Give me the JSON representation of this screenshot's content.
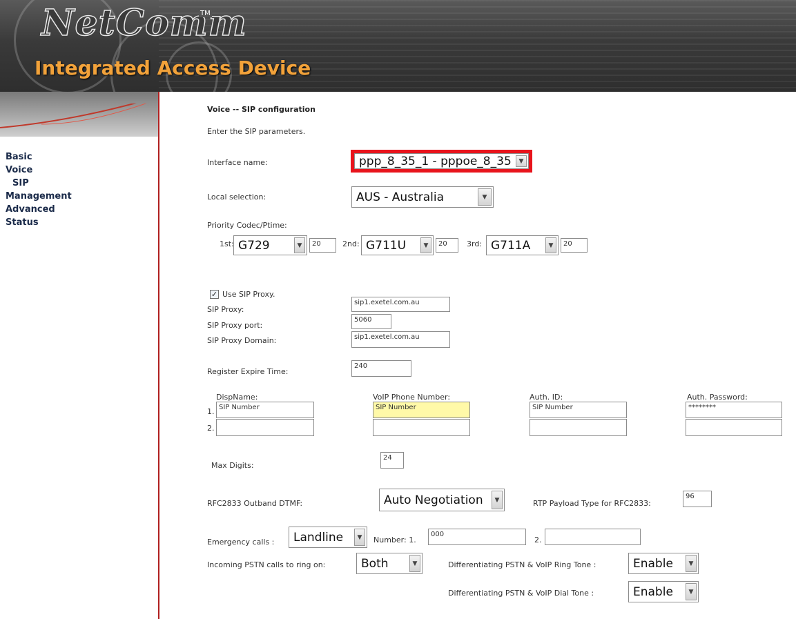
{
  "header": {
    "logo_text": "NetComm",
    "trademark": "TM",
    "product": "Integrated Access Device"
  },
  "nav": {
    "items": [
      "Basic",
      "Voice",
      "SIP",
      "Management",
      "Advanced",
      "Status"
    ]
  },
  "page": {
    "title": "Voice -- SIP configuration",
    "subtitle": "Enter the SIP parameters.",
    "interface": {
      "label": "Interface name:",
      "value": "ppp_8_35_1 - pppoe_8_35"
    },
    "locale": {
      "label": "Local selection:",
      "value": "AUS - Australia"
    },
    "codec": {
      "label": "Priority Codec/Ptime:",
      "first": {
        "label": "1st:",
        "codec": "G729",
        "ptime": "20"
      },
      "second": {
        "label": "2nd:",
        "codec": "G711U",
        "ptime": "20"
      },
      "third": {
        "label": "3rd:",
        "codec": "G711A",
        "ptime": "20"
      }
    },
    "proxy": {
      "use_label": "Use SIP Proxy.",
      "use_checked": true,
      "proxy_label": "SIP Proxy:",
      "proxy_value": "sip1.exetel.com.au",
      "port_label": "SIP Proxy port:",
      "port_value": "5060",
      "domain_label": "SIP Proxy Domain:",
      "domain_value": "sip1.exetel.com.au"
    },
    "register": {
      "label": "Register Expire Time:",
      "value": "240"
    },
    "accounts": {
      "headers": [
        "DispName:",
        "VoIP Phone Number:",
        "Auth. ID:",
        "Auth. Password:"
      ],
      "rows": [
        {
          "index": "1.",
          "disp": "SIP Number",
          "phone": "SIP Number",
          "auth": "SIP Number",
          "password": "********"
        },
        {
          "index": "2.",
          "disp": "",
          "phone": "",
          "auth": "",
          "password": ""
        }
      ]
    },
    "max_digits": {
      "label": "Max Digits:",
      "value": "24"
    },
    "dtmf": {
      "label": "RFC2833 Outband DTMF:",
      "value": "Auto Negotiation"
    },
    "rtp": {
      "label": "RTP Payload Type for RFC2833:",
      "value": "96"
    },
    "emergency": {
      "label": "Emergency calls :",
      "value": "Landline",
      "number_label": "Number: 1.",
      "number1": "000",
      "number2_label": "2.",
      "number2": ""
    },
    "incoming": {
      "label": "Incoming PSTN calls to ring on:",
      "value": "Both"
    },
    "ring_tone": {
      "label": "Differentiating PSTN & VoIP Ring Tone :",
      "value": "Enable"
    },
    "dial_tone": {
      "label": "Differentiating PSTN & VoIP Dial Tone :",
      "value": "Enable"
    }
  },
  "colors": {
    "highlight_border": "#e8141c",
    "nav_text": "#1b2b4a",
    "product_text": "#f2a23a",
    "divider": "#b02020",
    "highlight_field": "#fff9a8"
  },
  "icons": {
    "dropdown": "chevron-down-icon",
    "check": "checkmark-icon"
  }
}
